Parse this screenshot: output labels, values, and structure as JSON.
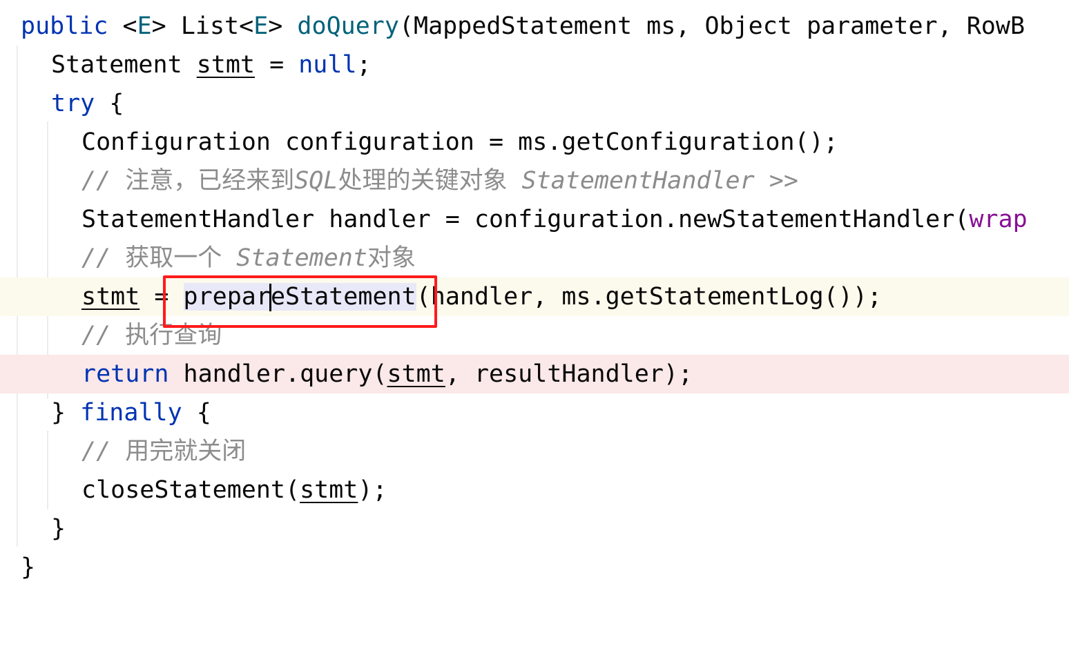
{
  "editor": {
    "lines": [
      {
        "parts": [
          "public",
          " <",
          "E",
          "> List<",
          "E",
          "> ",
          "doQuery",
          "(MappedStatement ms, Object parameter, RowB"
        ]
      },
      {
        "parts": [
          "Statement ",
          "stmt",
          " = ",
          "null",
          ";"
        ]
      },
      {
        "parts": [
          "try",
          " {"
        ]
      },
      {
        "parts": [
          "Configuration configuration = ms.getConfiguration();"
        ]
      },
      {
        "parts": [
          "// ",
          "注意，已经来到",
          "SQL",
          "处理的关键对象",
          " StatementHandler >>"
        ]
      },
      {
        "parts": [
          "StatementHandler handler = configuration.newStatementHandler(",
          "wrap"
        ]
      },
      {
        "parts": [
          "// ",
          "获取一个",
          " Statement",
          "对象"
        ]
      },
      {
        "parts": [
          "stmt",
          " = ",
          "prepar",
          "eStatement",
          "(handler, ms.getStatementLog());"
        ]
      },
      {
        "parts": [
          "// ",
          "执行查询"
        ]
      },
      {
        "parts": [
          "return",
          " handler.query(",
          "stmt",
          ", resultHandler);"
        ]
      },
      {
        "parts": [
          "} ",
          "finally",
          " {"
        ]
      },
      {
        "parts": [
          "// ",
          "用完就关闭"
        ]
      },
      {
        "parts": [
          "closeStatement(",
          "stmt",
          ");"
        ]
      },
      {
        "parts": [
          "}"
        ]
      },
      {
        "parts": [
          "}"
        ]
      }
    ]
  },
  "annotation": {
    "color": "#ff1a1a",
    "target": "prepareStatement"
  },
  "colors": {
    "keyword": "#0033b3",
    "type_param": "#00627a",
    "comment": "#8c8c8c",
    "param_field": "#871094",
    "current_line": "#fcfaed",
    "breakpoint_line": "#fbe8e8"
  }
}
